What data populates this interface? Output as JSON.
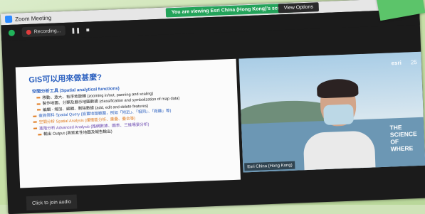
{
  "window": {
    "title": "Zoom Meeting"
  },
  "share_banner": "You are viewing Esri China (Hong Kong)'s screen",
  "view_options": "View Options",
  "toolbar": {
    "recording_label": "Recording..."
  },
  "slide": {
    "title": "GIS可以用來做甚麼?",
    "items": [
      {
        "text": "空間分析工具 (Spatial analytical functions)",
        "kind": "head"
      },
      {
        "text": "移動、放大、有序地旋轉 (zooming in/out, panning and scaling)",
        "kind": "sub"
      },
      {
        "text": "製作地圖、分類及展示地圖數據 (classification and symbolization of map data)",
        "kind": "sub"
      },
      {
        "text": "編輯 - 增加、編輯、刪除數據 (add, edit and delete features)",
        "kind": "sub"
      },
      {
        "text": "查詢資料 Spatial Query (設置地理範圍，例如「附近」、「相同」、「距離」等)",
        "kind": "blue"
      },
      {
        "text": "空間分析 Spatial Analysis (緩衝區分析、重疊、疊合等)",
        "kind": "orange"
      },
      {
        "text": "進階分析 Advanced Analysis (路網數據、圖表、三維場景分析)",
        "kind": "purple"
      },
      {
        "text": "輸出 Output (高質素性地圖及報告輸出)",
        "kind": "sub"
      }
    ]
  },
  "video": {
    "logo": "esri",
    "badge": "25",
    "banner": [
      "THE",
      "SCIENCE",
      "OF",
      "WHERE"
    ],
    "name_tag": "Esri China (Hong Kong)"
  },
  "join_audio": "Click to join audio"
}
